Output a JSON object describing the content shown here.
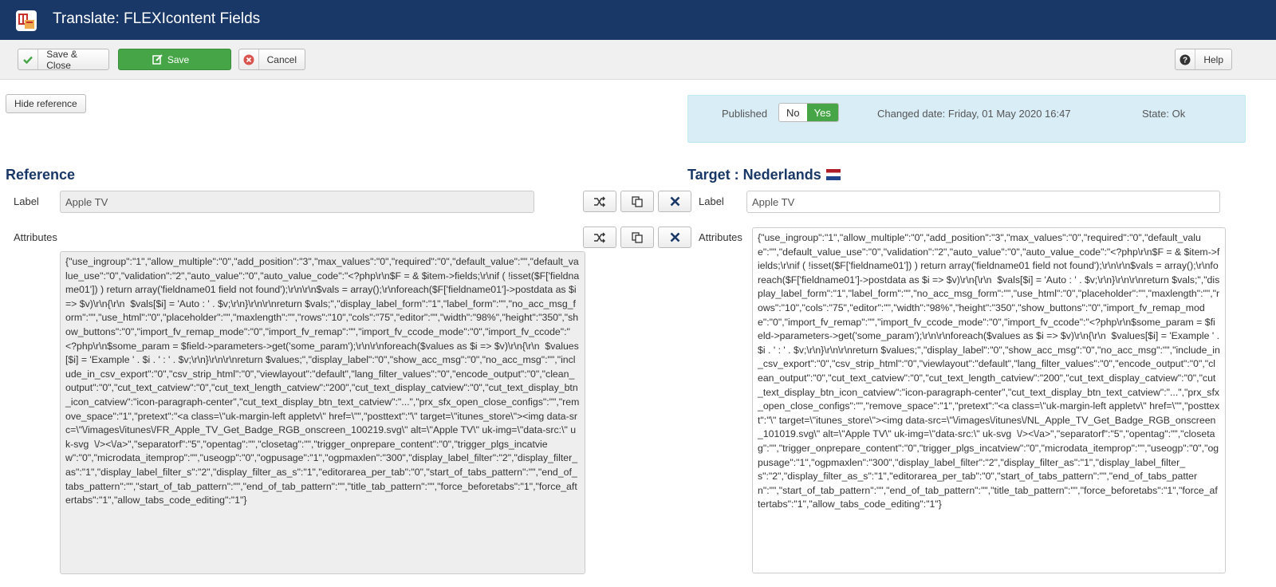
{
  "header": {
    "title": "Translate: FLEXIcontent Fields"
  },
  "toolbar": {
    "save_close_label": "Save & Close",
    "save_label": "Save",
    "cancel_label": "Cancel",
    "help_label": "Help"
  },
  "hide_reference_label": "Hide reference",
  "publish": {
    "published_label": "Published",
    "no_label": "No",
    "yes_label": "Yes",
    "changed_date": "Changed date: Friday, 01 May 2020 16:47",
    "state": "State: Ok"
  },
  "reference": {
    "heading": "Reference",
    "label_caption": "Label",
    "label_value": "Apple TV",
    "attributes_caption": "Attributes",
    "attributes_value": "{\"use_ingroup\":\"1\",\"allow_multiple\":\"0\",\"add_position\":\"3\",\"max_values\":\"0\",\"required\":\"0\",\"default_value\":\"\",\"default_value_use\":\"0\",\"validation\":\"2\",\"auto_value\":\"0\",\"auto_value_code\":\"<?php\\r\\n$F = & $item->fields;\\r\\nif ( !isset($F['fieldname01']) ) return array('fieldname01 field not found');\\r\\n\\r\\n$vals = array();\\r\\nforeach($F['fieldname01']->postdata as $i => $v)\\r\\n{\\r\\n  $vals[$i] = 'Auto : ' . $v;\\r\\n}\\r\\n\\r\\nreturn $vals;\",\"display_label_form\":\"1\",\"label_form\":\"\",\"no_acc_msg_form\":\"\",\"use_html\":\"0\",\"placeholder\":\"\",\"maxlength\":\"\",\"rows\":\"10\",\"cols\":\"75\",\"editor\":\"\",\"width\":\"98%\",\"height\":\"350\",\"show_buttons\":\"0\",\"import_fv_remap_mode\":\"0\",\"import_fv_remap\":\"\",\"import_fv_ccode_mode\":\"0\",\"import_fv_ccode\":\"<?php\\r\\n$some_param = $field->parameters->get('some_param');\\r\\n\\r\\nforeach($values as $i => $v)\\r\\n{\\r\\n  $values[$i] = 'Example ' . $i . ' : ' . $v;\\r\\n}\\r\\n\\r\\nreturn $values;\",\"display_label\":\"0\",\"show_acc_msg\":\"0\",\"no_acc_msg\":\"\",\"include_in_csv_export\":\"0\",\"csv_strip_html\":\"0\",\"viewlayout\":\"default\",\"lang_filter_values\":\"0\",\"encode_output\":\"0\",\"clean_output\":\"0\",\"cut_text_catview\":\"0\",\"cut_text_length_catview\":\"200\",\"cut_text_display_catview\":\"0\",\"cut_text_display_btn_icon_catview\":\"icon-paragraph-center\",\"cut_text_display_btn_text_catview\":\"...\",\"prx_sfx_open_close_configs\":\"\",\"remove_space\":\"1\",\"pretext\":\"<a class=\\\"uk-margin-left appletv\\\" href=\\\"\",\"posttext\":\"\\\" target=\\\"itunes_store\\\"><img data-src=\\\"\\/images\\/itunes\\/FR_Apple_TV_Get_Badge_RGB_onscreen_100219.svg\\\" alt=\\\"Apple TV\\\" uk-img=\\\"data-src:\\\" uk-svg  \\/><\\/a>\",\"separatorf\":\"5\",\"opentag\":\"\",\"closetag\":\"\",\"trigger_onprepare_content\":\"0\",\"trigger_plgs_incatview\":\"0\",\"microdata_itemprop\":\"\",\"useogp\":\"0\",\"ogpusage\":\"1\",\"ogpmaxlen\":\"300\",\"display_label_filter\":\"2\",\"display_filter_as\":\"1\",\"display_label_filter_s\":\"2\",\"display_filter_as_s\":\"1\",\"editorarea_per_tab\":\"0\",\"start_of_tabs_pattern\":\"\",\"end_of_tabs_pattern\":\"\",\"start_of_tab_pattern\":\"\",\"end_of_tab_pattern\":\"\",\"title_tab_pattern\":\"\",\"force_beforetabs\":\"1\",\"force_aftertabs\":\"1\",\"allow_tabs_code_editing\":\"1\"}"
  },
  "target": {
    "heading": "Target : Nederlands",
    "label_caption": "Label",
    "label_value": "Apple TV",
    "attributes_caption": "Attributes",
    "attributes_value": "{\"use_ingroup\":\"1\",\"allow_multiple\":\"0\",\"add_position\":\"3\",\"max_values\":\"0\",\"required\":\"0\",\"default_value\":\"\",\"default_value_use\":\"0\",\"validation\":\"2\",\"auto_value\":\"0\",\"auto_value_code\":\"<?php\\r\\n$F = & $item->fields;\\r\\nif ( !isset($F['fieldname01']) ) return array('fieldname01 field not found');\\r\\n\\r\\n$vals = array();\\r\\nforeach($F['fieldname01']->postdata as $i => $v)\\r\\n{\\r\\n  $vals[$i] = 'Auto : ' . $v;\\r\\n}\\r\\n\\r\\nreturn $vals;\",\"display_label_form\":\"1\",\"label_form\":\"\",\"no_acc_msg_form\":\"\",\"use_html\":\"0\",\"placeholder\":\"\",\"maxlength\":\"\",\"rows\":\"10\",\"cols\":\"75\",\"editor\":\"\",\"width\":\"98%\",\"height\":\"350\",\"show_buttons\":\"0\",\"import_fv_remap_mode\":\"0\",\"import_fv_remap\":\"\",\"import_fv_ccode_mode\":\"0\",\"import_fv_ccode\":\"<?php\\r\\n$some_param = $field->parameters->get('some_param');\\r\\n\\r\\nforeach($values as $i => $v)\\r\\n{\\r\\n  $values[$i] = 'Example ' . $i . ' : ' . $v;\\r\\n}\\r\\n\\r\\nreturn $values;\",\"display_label\":\"0\",\"show_acc_msg\":\"0\",\"no_acc_msg\":\"\",\"include_in_csv_export\":\"0\",\"csv_strip_html\":\"0\",\"viewlayout\":\"default\",\"lang_filter_values\":\"0\",\"encode_output\":\"0\",\"clean_output\":\"0\",\"cut_text_catview\":\"0\",\"cut_text_length_catview\":\"200\",\"cut_text_display_catview\":\"0\",\"cut_text_display_btn_icon_catview\":\"icon-paragraph-center\",\"cut_text_display_btn_text_catview\":\"...\",\"prx_sfx_open_close_configs\":\"\",\"remove_space\":\"1\",\"pretext\":\"<a class=\\\"uk-margin-left appletv\\\" href=\\\"\",\"posttext\":\"\\\" target=\\\"itunes_store\\\"><img data-src=\\\"\\/images\\/itunes\\/NL_Apple_TV_Get_Badge_RGB_onscreen_101019.svg\\\" alt=\\\"Apple TV\\\" uk-img=\\\"data-src:\\\" uk-svg  \\/><\\/a>\",\"separatorf\":\"5\",\"opentag\":\"\",\"closetag\":\"\",\"trigger_onprepare_content\":\"0\",\"trigger_plgs_incatview\":\"0\",\"microdata_itemprop\":\"\",\"useogp\":\"0\",\"ogpusage\":\"1\",\"ogpmaxlen\":\"300\",\"display_label_filter\":\"2\",\"display_filter_as\":\"1\",\"display_label_filter_s\":\"2\",\"display_filter_as_s\":\"1\",\"editorarea_per_tab\":\"0\",\"start_of_tabs_pattern\":\"\",\"end_of_tabs_pattern\":\"\",\"start_of_tab_pattern\":\"\",\"end_of_tab_pattern\":\"\",\"title_tab_pattern\":\"\",\"force_beforetabs\":\"1\",\"force_aftertabs\":\"1\",\"allow_tabs_code_editing\":\"1\"}"
  },
  "icons": {
    "logo": "flexicontent-logo-icon",
    "save_close": "check-icon",
    "save": "edit-icon",
    "cancel": "close-circle-icon",
    "help": "question-icon",
    "translate": "shuffle-icon",
    "copy": "copy-icon",
    "clear": "x-icon"
  },
  "colors": {
    "header_bg": "#1a3867",
    "save_green": "#46a546",
    "info_bg": "#d9edf7"
  }
}
